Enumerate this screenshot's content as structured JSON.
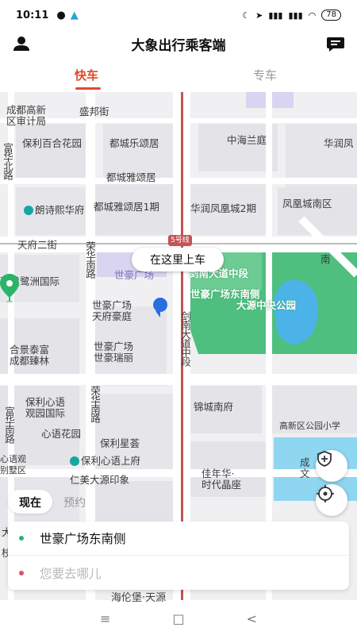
{
  "status_bar": {
    "time": "10:11",
    "battery": "78"
  },
  "header": {
    "title": "大象出行乘客端"
  },
  "tabs": [
    {
      "label": "快车",
      "active": true
    },
    {
      "label": "专车",
      "active": false
    }
  ],
  "map": {
    "pickup_bubble": "在这里上车",
    "labels": {
      "l1": "成都高新\n区审计局",
      "l2": "盛邦街",
      "l3": "保利百合花园",
      "l4": "都城乐颂居",
      "l5": "中海兰庭",
      "l6": "华润凤",
      "l7": "富华北路",
      "l8": "都城雅颂居",
      "l9": "朗诗熙华府",
      "l10": "都城雅颂居1期",
      "l11": "华润凤凰城2期",
      "l12": "凤凰城南区",
      "l13": "天府二街",
      "l14": "荣华南路",
      "l15": "5号线",
      "l16": "南",
      "l17": "世豪广场",
      "l18": "剑南大道中段",
      "l19": "建发鹭洲国际",
      "l20": "世豪广场东南侧",
      "l21": "大源中央公园",
      "l22": "世豪广场\n天府豪庭",
      "l23": "剑南大道中段",
      "l24": "世豪广场\n世豪瑞丽",
      "l25": "合景泰富\n成都臻林",
      "l26": "保利心语\n观园国际",
      "l27": "锦城南府",
      "l28": "荣华南路",
      "l29": "高新区公园小学",
      "l30": "富华南路",
      "l31": "心语花园",
      "l32": "保利星荟",
      "l33": "心语观\n别墅区",
      "l34": "保利心语上府",
      "l35": "佳年华·\n时代晶座",
      "l36": "成\n文",
      "l37": "仁美大源印象",
      "l38": "大",
      "l39": "枝",
      "l40": "海伦堡·天源"
    }
  },
  "time_tabs": [
    {
      "label": "现在",
      "active": true
    },
    {
      "label": "预约",
      "active": false
    }
  ],
  "address": {
    "from": "世豪广场东南侧",
    "to_placeholder": "您要去哪儿"
  },
  "nav": {
    "menu": "≡",
    "home": "□",
    "back": "<"
  },
  "colors": {
    "accent": "#e04a2b",
    "park": "#49b97a",
    "water": "#4cb3e8",
    "road": "#ffffff",
    "metro_line": "#c25454"
  }
}
